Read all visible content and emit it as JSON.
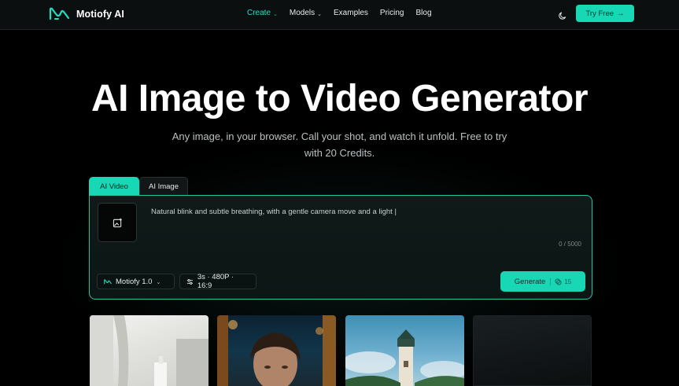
{
  "nav": {
    "brand": "Motiofy AI",
    "items": [
      {
        "label": "Create",
        "has_dropdown": true,
        "active": true
      },
      {
        "label": "Models",
        "has_dropdown": true,
        "active": false
      },
      {
        "label": "Examples",
        "has_dropdown": false,
        "active": false
      },
      {
        "label": "Pricing",
        "has_dropdown": false,
        "active": false
      },
      {
        "label": "Blog",
        "has_dropdown": false,
        "active": false
      }
    ],
    "theme_icon": "moon-icon",
    "cta_label": "Try Free",
    "cta_arrow": "→"
  },
  "hero": {
    "title": "AI Image to Video Generator",
    "subtitle": "Any image, in your browser. Call your shot, and watch it unfold. Free to try with 20 Credits."
  },
  "tabs": [
    {
      "label": "AI Video",
      "active": true
    },
    {
      "label": "AI Image",
      "active": false
    }
  ],
  "editor": {
    "upload_icon": "image-upload-icon",
    "prompt": "Natural blink and subtle breathing, with a gentle camera move and a light |",
    "counter": "0 / 5000",
    "model_label": "Motiofy 1.0",
    "settings_label": "3s · 480P · 16:9",
    "generate_label": "Generate",
    "credit_cost": "15"
  },
  "gallery": {
    "items": [
      {
        "name": "gallery-item-interior"
      },
      {
        "name": "gallery-item-portrait"
      },
      {
        "name": "gallery-item-lighthouse"
      },
      {
        "name": "gallery-item-dark"
      }
    ]
  },
  "colors": {
    "accent": "#17d7b5",
    "background": "#000000",
    "panel_border": "#1fc6a6",
    "nav_active": "#1ee0c0"
  }
}
